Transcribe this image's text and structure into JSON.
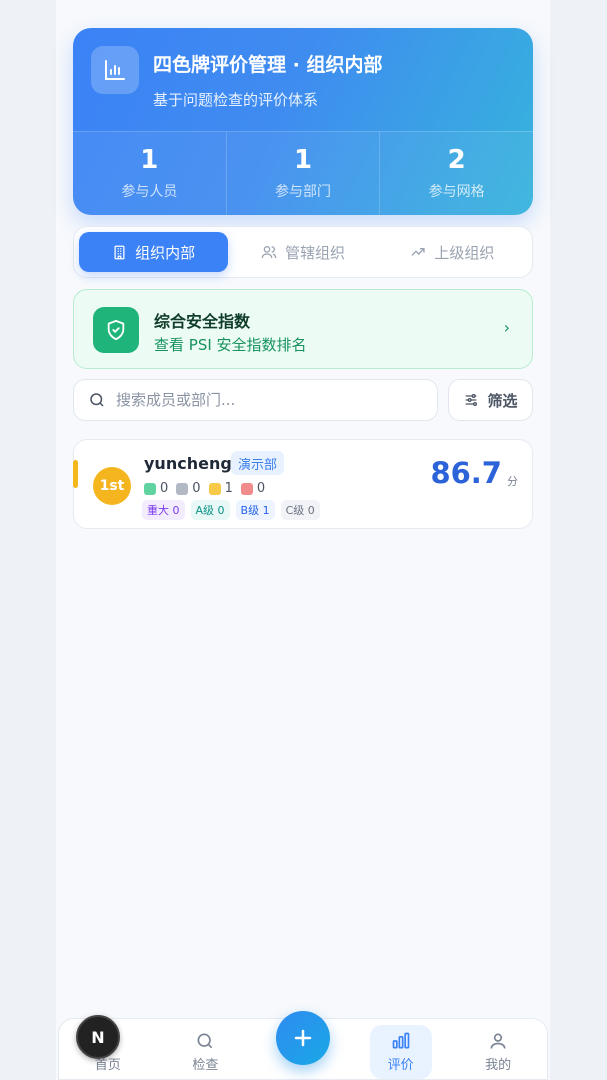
{
  "header": {
    "title": "四色牌评价管理 · 组织内部",
    "subtitle": "基于问题检查的评价体系",
    "icon": "bar-chart-icon",
    "stats": [
      {
        "value": "1",
        "label": "参与人员"
      },
      {
        "value": "1",
        "label": "参与部门"
      },
      {
        "value": "2",
        "label": "参与网格"
      }
    ]
  },
  "tabs": [
    {
      "label": "组织内部",
      "icon": "building-icon",
      "active": true
    },
    {
      "label": "管辖组织",
      "icon": "users-icon",
      "active": false
    },
    {
      "label": "上级组织",
      "icon": "trending-up-icon",
      "active": false
    }
  ],
  "psi": {
    "title": "综合安全指数",
    "subtitle": "查看 PSI 安全指数排名",
    "icon": "shield-icon"
  },
  "search": {
    "placeholder": "搜索成员或部门..."
  },
  "filter": {
    "label": "筛选"
  },
  "members": [
    {
      "rank": "1st",
      "name": "yuncheng",
      "department": "演示部",
      "colors": [
        {
          "color": "#5fd3a0",
          "count": "0"
        },
        {
          "color": "#b3b9c4",
          "count": "0"
        },
        {
          "color": "#f7c948",
          "count": "1"
        },
        {
          "color": "#f28b8b",
          "count": "0"
        }
      ],
      "levels": [
        {
          "label": "重大 0",
          "color": "#7c3aed"
        },
        {
          "label": "A级 0",
          "color": "#0d9488"
        },
        {
          "label": "B级 1",
          "color": "#2563eb"
        },
        {
          "label": "C级 0",
          "color": "#6b7280"
        }
      ],
      "score": "86.7",
      "score_unit": "分"
    }
  ],
  "nav": [
    {
      "label": "首页",
      "icon": "home-icon"
    },
    {
      "label": "检查",
      "icon": "search-icon"
    },
    {
      "label": "评价",
      "icon": "bar-chart-icon",
      "active": true
    },
    {
      "label": "我的",
      "icon": "user-icon"
    }
  ],
  "fab": {
    "icon": "plus-icon"
  },
  "dev_badge": {
    "label": "N"
  }
}
